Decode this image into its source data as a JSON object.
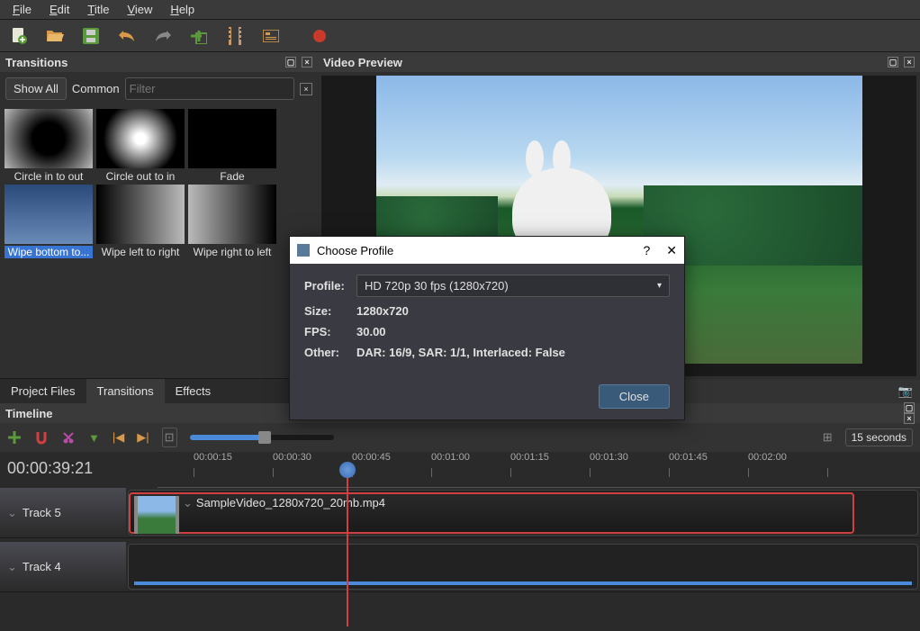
{
  "menu": {
    "file": "File",
    "edit": "Edit",
    "title": "Title",
    "view": "View",
    "help": "Help"
  },
  "panels": {
    "transitions": "Transitions",
    "preview": "Video Preview",
    "timeline": "Timeline"
  },
  "filter": {
    "showall": "Show All",
    "common": "Common",
    "placeholder": "Filter"
  },
  "transitions": [
    {
      "label": "Circle in to out",
      "cls": "t-circin"
    },
    {
      "label": "Circle out to in",
      "cls": "t-circout"
    },
    {
      "label": "Fade",
      "cls": ""
    },
    {
      "label": "Wipe bottom to...",
      "cls": "t-wipeb",
      "selected": true
    },
    {
      "label": "Wipe left to right",
      "cls": "t-wipel"
    },
    {
      "label": "Wipe right to left",
      "cls": "t-wiper"
    }
  ],
  "tabs": {
    "project": "Project Files",
    "transitions": "Transitions",
    "effects": "Effects"
  },
  "zoom_label": "15 seconds",
  "timecode": "00:00:39:21",
  "ruler": [
    "00:00:15",
    "00:00:30",
    "00:00:45",
    "00:01:00",
    "00:01:15",
    "00:01:30",
    "00:01:45",
    "00:02:00"
  ],
  "tracks": [
    {
      "name": "Track 5",
      "clip": "SampleVideo_1280x720_20mb.mp4"
    },
    {
      "name": "Track 4"
    }
  ],
  "dialog": {
    "title": "Choose Profile",
    "profile_label": "Profile:",
    "profile_value": "HD 720p 30 fps (1280x720)",
    "size_label": "Size:",
    "size_value": "1280x720",
    "fps_label": "FPS:",
    "fps_value": "30.00",
    "other_label": "Other:",
    "other_value": "DAR: 16/9, SAR: 1/1, Interlaced: False",
    "close": "Close"
  }
}
